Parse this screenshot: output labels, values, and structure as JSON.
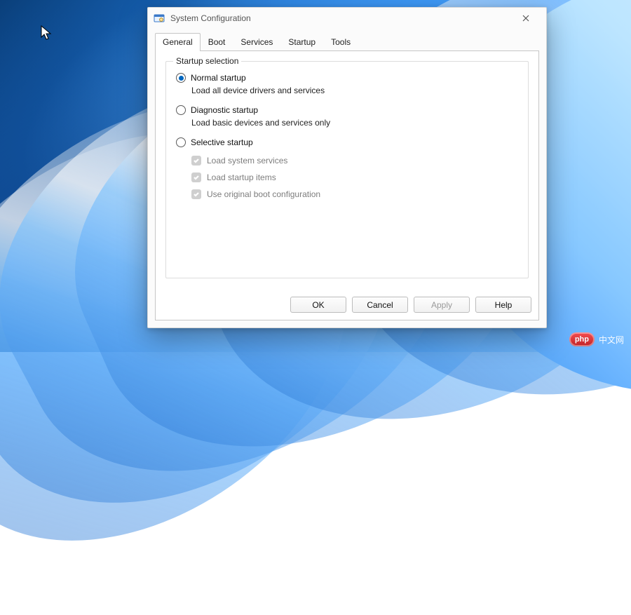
{
  "window": {
    "title": "System Configuration"
  },
  "tabs": [
    {
      "label": "General",
      "active": true
    },
    {
      "label": "Boot",
      "active": false
    },
    {
      "label": "Services",
      "active": false
    },
    {
      "label": "Startup",
      "active": false
    },
    {
      "label": "Tools",
      "active": false
    }
  ],
  "group": {
    "title": "Startup selection",
    "options": [
      {
        "label": "Normal startup",
        "description": "Load all device drivers and services",
        "checked": true
      },
      {
        "label": "Diagnostic startup",
        "description": "Load basic devices and services only",
        "checked": false
      },
      {
        "label": "Selective startup",
        "description": "",
        "checked": false
      }
    ],
    "selective_suboptions": [
      {
        "label": "Load system services",
        "checked": true,
        "enabled": false
      },
      {
        "label": "Load startup items",
        "checked": true,
        "enabled": false
      },
      {
        "label": "Use original boot configuration",
        "checked": true,
        "enabled": false
      }
    ]
  },
  "buttons": {
    "ok": "OK",
    "cancel": "Cancel",
    "apply": "Apply",
    "help": "Help",
    "apply_enabled": false
  },
  "watermark": {
    "badge": "php",
    "text": "中文网"
  }
}
